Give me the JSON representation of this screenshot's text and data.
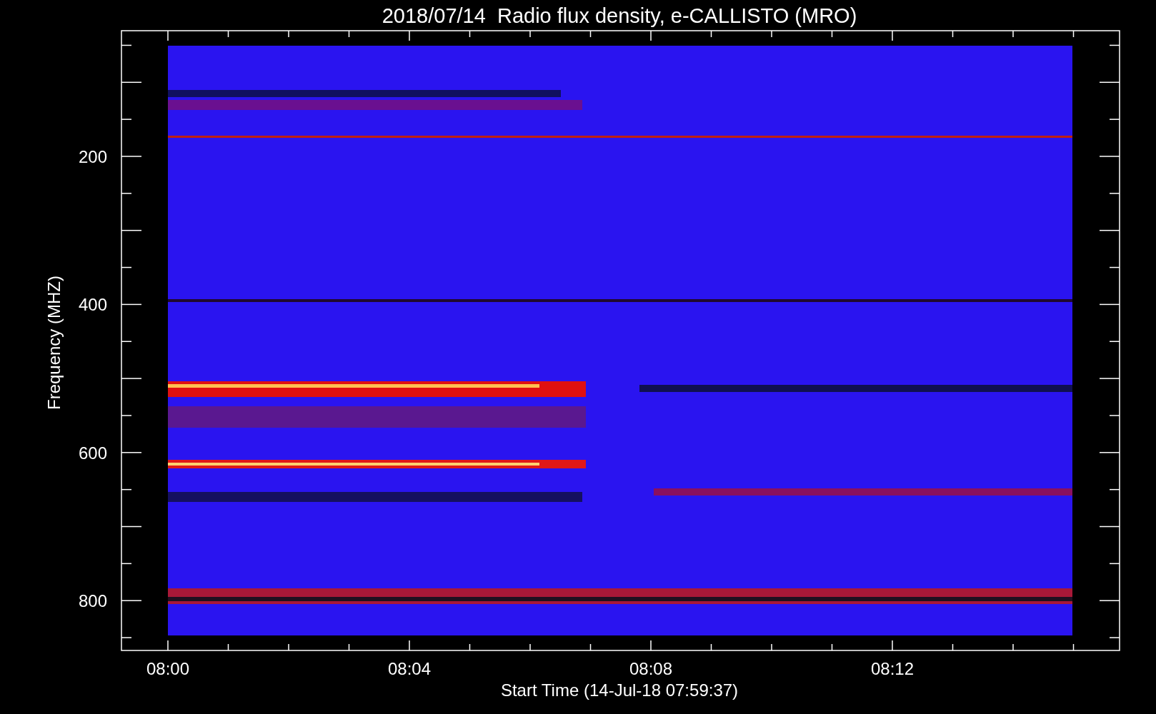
{
  "title": "2018/07/14  Radio flux density, e-CALLISTO (MRO)",
  "y_axis": {
    "label": "Frequency (MHZ)",
    "tick_labels": [
      "200",
      "400",
      "600",
      "800"
    ]
  },
  "x_axis": {
    "label": "Start Time (14-Jul-18 07:59:37)",
    "tick_labels": [
      "08:00",
      "08:04",
      "08:08",
      "08:12"
    ]
  }
}
